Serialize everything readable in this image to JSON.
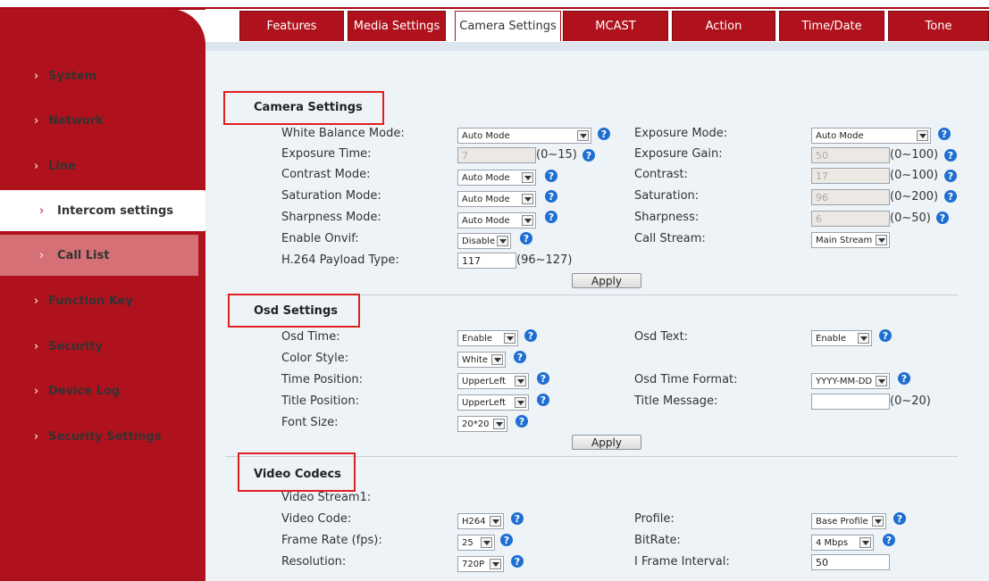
{
  "sidebar": {
    "items": [
      {
        "label": "System"
      },
      {
        "label": "Network"
      },
      {
        "label": "Line"
      },
      {
        "label": "Intercom settings"
      },
      {
        "label": "Call List"
      },
      {
        "label": "Function Key"
      },
      {
        "label": "Security"
      },
      {
        "label": "Device Log"
      },
      {
        "label": "Security Settings"
      }
    ],
    "chevron": "›"
  },
  "tabs": [
    {
      "label": "Features"
    },
    {
      "label": "Media Settings"
    },
    {
      "label": "Camera Settings"
    },
    {
      "label": "MCAST"
    },
    {
      "label": "Action"
    },
    {
      "label": "Time/Date"
    },
    {
      "label": "Tone"
    }
  ],
  "camera": {
    "title": "Camera Settings",
    "white_balance_label": "White Balance Mode:",
    "white_balance_value": "Auto Mode",
    "exposure_mode_label": "Exposure Mode:",
    "exposure_mode_value": "Auto Mode",
    "exposure_time_label": "Exposure Time:",
    "exposure_time_value": "7",
    "exposure_time_range": "(0~15)",
    "exposure_gain_label": "Exposure Gain:",
    "exposure_gain_value": "50",
    "exposure_gain_range": "(0~100)",
    "contrast_mode_label": "Contrast Mode:",
    "contrast_mode_value": "Auto Mode",
    "contrast_label": "Contrast:",
    "contrast_value": "17",
    "contrast_range": "(0~100)",
    "saturation_mode_label": "Saturation Mode:",
    "saturation_mode_value": "Auto Mode",
    "saturation_label": "Saturation:",
    "saturation_value": "96",
    "saturation_range": "(0~200)",
    "sharpness_mode_label": "Sharpness Mode:",
    "sharpness_mode_value": "Auto Mode",
    "sharpness_label": "Sharpness:",
    "sharpness_value": "6",
    "sharpness_range": "(0~50)",
    "onvif_label": "Enable Onvif:",
    "onvif_value": "Disable",
    "call_stream_label": "Call Stream:",
    "call_stream_value": "Main Stream",
    "payload_label": "H.264 Payload Type:",
    "payload_value": "117",
    "payload_range": "(96~127)",
    "apply": "Apply"
  },
  "osd": {
    "title": "Osd Settings",
    "osd_time_label": "Osd Time:",
    "osd_time_value": "Enable",
    "osd_text_label": "Osd Text:",
    "osd_text_value": "Enable",
    "color_style_label": "Color Style:",
    "color_style_value": "White",
    "time_position_label": "Time Position:",
    "time_position_value": "UpperLeft",
    "time_format_label": "Osd Time Format:",
    "time_format_value": "YYYY-MM-DD",
    "title_position_label": "Title Position:",
    "title_position_value": "UpperLeft",
    "title_message_label": "Title Message:",
    "title_message_value": "",
    "title_message_range": "(0~20)",
    "font_size_label": "Font Size:",
    "font_size_value": "20*20",
    "apply": "Apply"
  },
  "video": {
    "title": "Video Codecs",
    "stream1_label": "Video Stream1:",
    "video_code_label": "Video Code:",
    "video_code_value": "H264",
    "profile_label": "Profile:",
    "profile_value": "Base Profile",
    "frame_rate_label": "Frame Rate (fps):",
    "frame_rate_value": "25",
    "bitrate_label": "BitRate:",
    "bitrate_value": "4 Mbps",
    "resolution_label": "Resolution:",
    "resolution_value": "720P",
    "iframe_label": "I Frame Interval:",
    "iframe_value": "50"
  },
  "help_glyph": "?",
  "colors": {
    "brand_red": "#b0121d",
    "help_blue": "#1e6fd1",
    "highlight_box": "#e02020"
  }
}
